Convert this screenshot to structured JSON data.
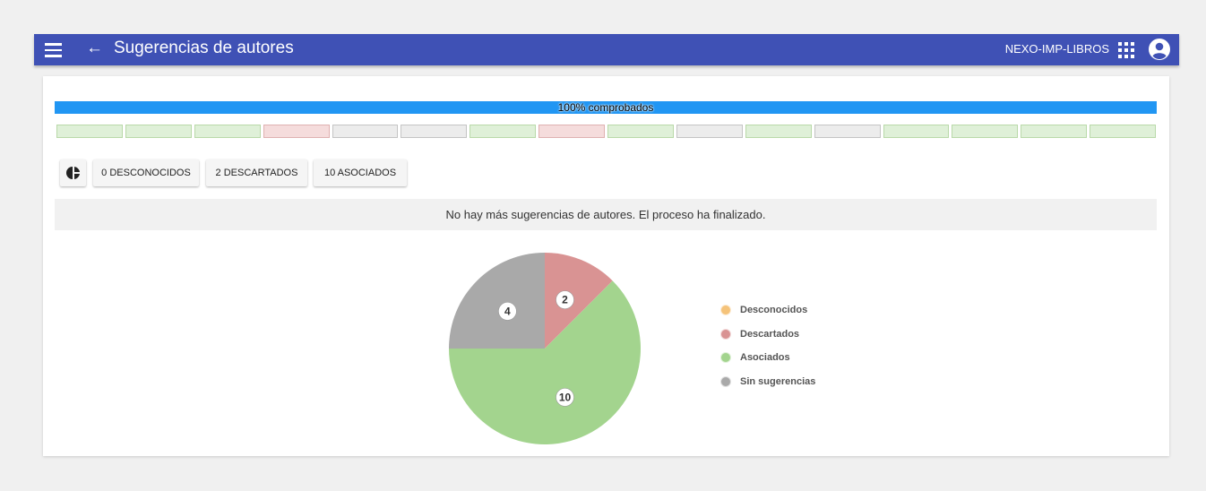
{
  "appbar": {
    "back_icon": "arrow-left-icon",
    "back_glyph": "←",
    "title": "Sugerencias de autores",
    "app_name": "NEXO-IMP-LIBROS",
    "apps_icon": "apps-grid-icon",
    "account_icon": "account-circle-icon",
    "color": "#3f51b5"
  },
  "progress": {
    "label": "100% comprobados",
    "value": 1.0,
    "color": "#2196f3"
  },
  "segments": [
    "ok",
    "ok",
    "ok",
    "bad",
    "none",
    "none",
    "ok",
    "bad",
    "ok",
    "none",
    "ok",
    "none",
    "ok",
    "ok",
    "ok",
    "ok"
  ],
  "buttons": {
    "chart_icon": "pie-chart-icon",
    "desconocidos": "0 DESCONOCIDOS",
    "descartados": "2 DESCARTADOS",
    "asociados": "10 ASOCIADOS"
  },
  "info_message": "No hay más sugerencias de autores. El proceso ha finalizado.",
  "chart_data": {
    "type": "pie",
    "labels": [
      "Desconocidos",
      "Descartados",
      "Asociados",
      "Sin sugerencias"
    ],
    "values": [
      0,
      2,
      10,
      4
    ],
    "colors": [
      "#f5c37a",
      "#d99393",
      "#a3d48e",
      "#a9a9a9"
    ],
    "legend_position": "right"
  }
}
